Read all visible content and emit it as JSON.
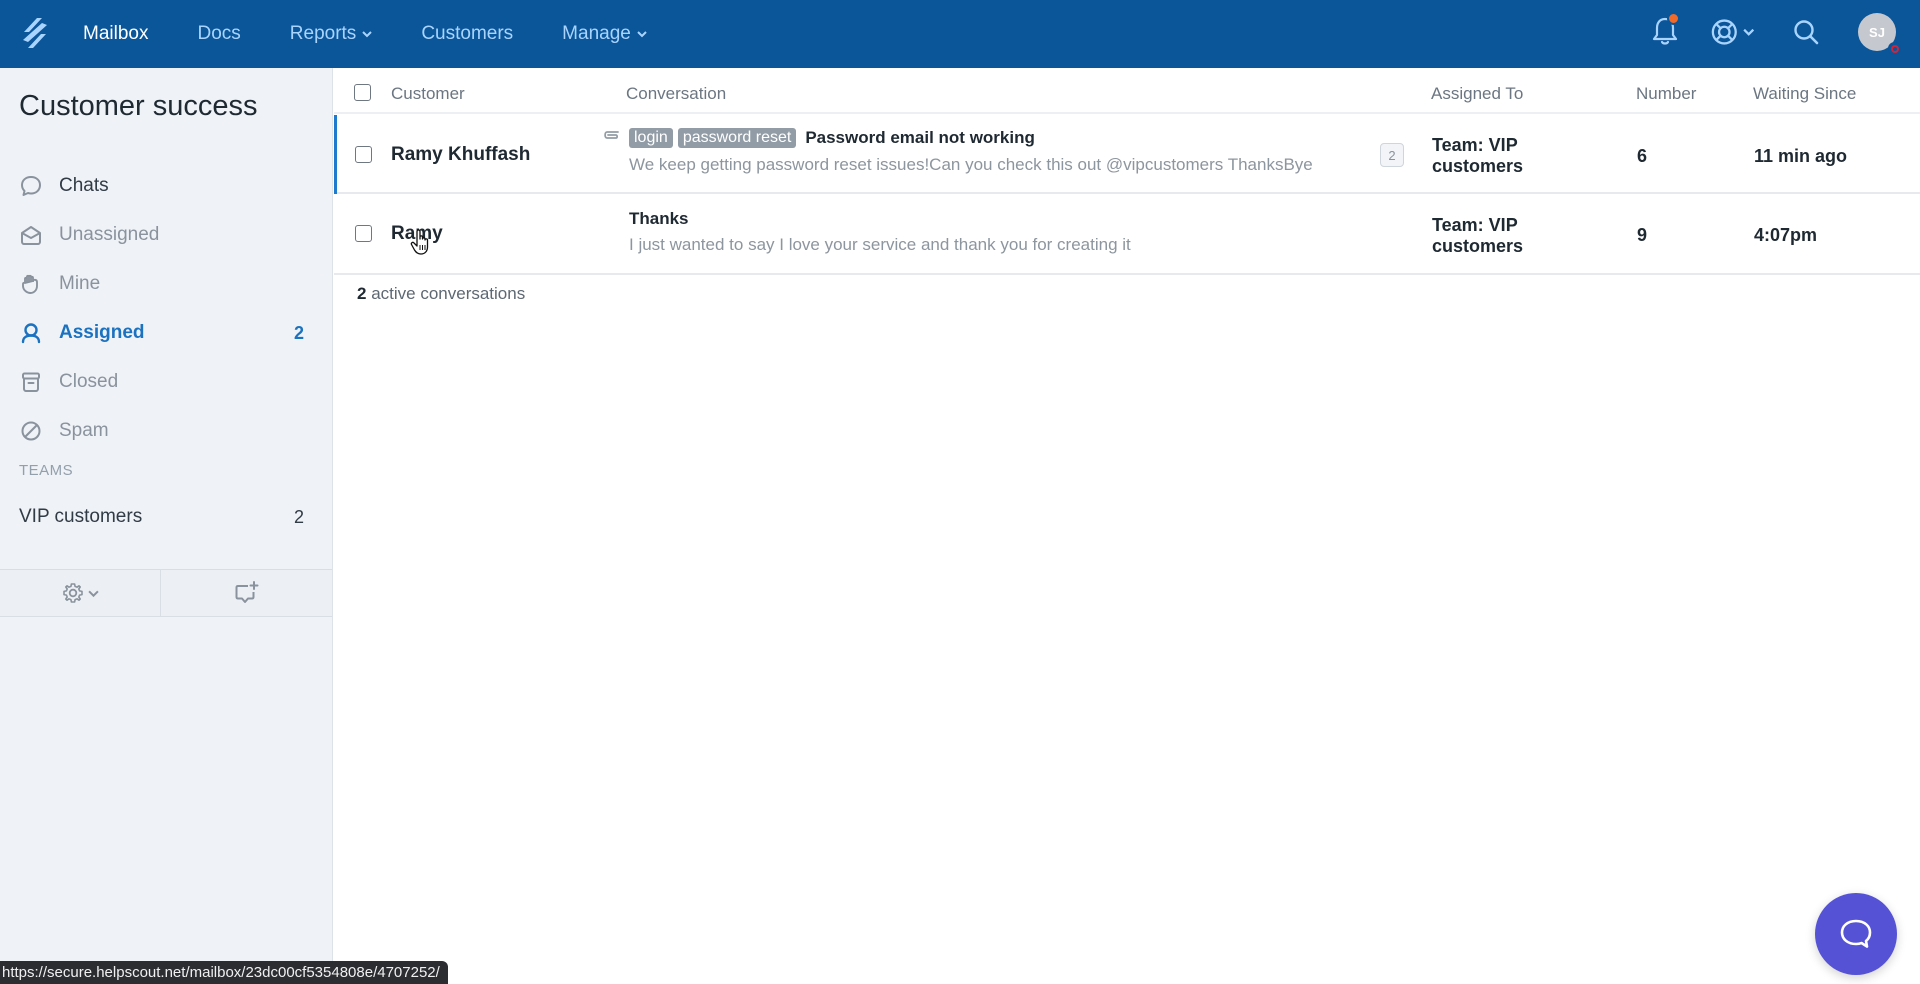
{
  "nav": {
    "logo": "helpscout-logo-icon",
    "items": [
      {
        "label": "Mailbox",
        "active": true,
        "dropdown": false
      },
      {
        "label": "Docs",
        "active": false,
        "dropdown": false
      },
      {
        "label": "Reports",
        "active": false,
        "dropdown": true
      },
      {
        "label": "Customers",
        "active": false,
        "dropdown": false
      },
      {
        "label": "Manage",
        "active": false,
        "dropdown": true
      }
    ],
    "right": {
      "notifications_icon": "bell-icon",
      "has_unread_notification": true,
      "help_icon": "lifebuoy-icon",
      "search_icon": "search-icon",
      "avatar_initials": "SJ",
      "avatar_status": "away"
    },
    "colors": {
      "bar": "#0b5599",
      "link": "#a9d4ff",
      "active": "#ffffff",
      "notif_dot": "#f26a2a"
    }
  },
  "sidebar": {
    "title": "Customer success",
    "folders": [
      {
        "label": "Chats",
        "icon": "chat-bubble-icon",
        "count": null,
        "active": false
      },
      {
        "label": "Unassigned",
        "icon": "envelope-open-icon",
        "count": null,
        "active": false
      },
      {
        "label": "Mine",
        "icon": "hand-icon",
        "count": null,
        "active": false
      },
      {
        "label": "Assigned",
        "icon": "user-icon",
        "count": "2",
        "active": true
      },
      {
        "label": "Closed",
        "icon": "archive-icon",
        "count": null,
        "active": false
      },
      {
        "label": "Spam",
        "icon": "block-icon",
        "count": null,
        "active": false
      }
    ],
    "teams_heading": "TEAMS",
    "teams": [
      {
        "label": "VIP customers",
        "count": "2"
      }
    ],
    "footer": {
      "settings_icon": "gear-icon",
      "new_conversation_icon": "new-conversation-icon"
    },
    "colors": {
      "active": "#1a72c0",
      "bg": "#eff2f7"
    }
  },
  "table": {
    "columns": {
      "customer": "Customer",
      "conversation": "Conversation",
      "assigned_to": "Assigned To",
      "number": "Number",
      "waiting_since": "Waiting Since"
    },
    "rows": [
      {
        "customer": "Ramy Khuffash",
        "has_attachment": true,
        "tags": [
          "login",
          "password reset"
        ],
        "subject": "Password email not working",
        "preview": "We keep getting password reset issues!Can you check this out @vipcustomers ThanksBye",
        "thread_count": "2",
        "assigned_to": [
          "Team: VIP",
          "customers"
        ],
        "number": "6",
        "waiting_since": "11 min ago",
        "selected": true
      },
      {
        "customer": "Ramy",
        "has_attachment": false,
        "tags": [],
        "subject": "Thanks",
        "preview": "I just wanted to say I love your service and thank you for creating it",
        "thread_count": null,
        "assigned_to": [
          "Team: VIP",
          "customers"
        ],
        "number": "9",
        "waiting_since": "4:07pm",
        "selected": false
      }
    ],
    "summary": {
      "count": "2",
      "label": " active conversations"
    }
  },
  "beacon": {
    "icon": "chat-bubble-icon",
    "color": "#5552d6"
  },
  "statusbar": {
    "url": "https://secure.helpscout.net/mailbox/23dc00cf5354808e/4707252/"
  }
}
